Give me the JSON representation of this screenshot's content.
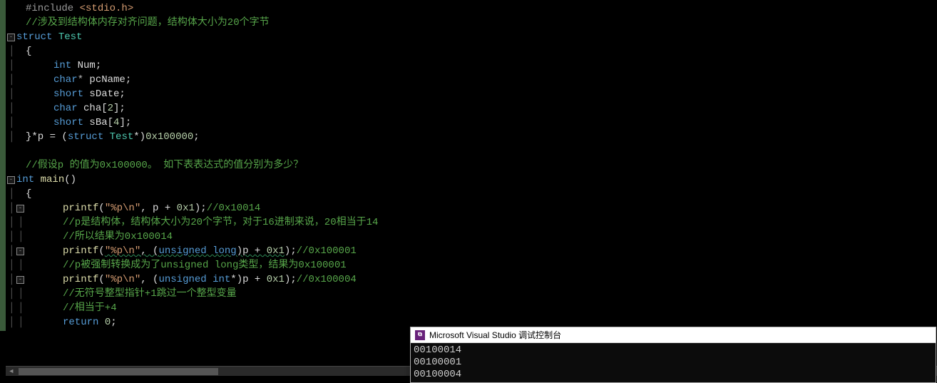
{
  "code": {
    "l1_inc": "#include",
    "l1_hdr": " <stdio.h>",
    "l2_cmt": "//涉及到结构体内存对齐问题，结构体大小为20个字节",
    "l3_struct": "struct",
    "l3_name": " Test",
    "l4_brace": "{",
    "l5_type": "int",
    "l5_name": " Num;",
    "l6_type": "char",
    "l6_ptr": "*",
    "l6_name": " pcName;",
    "l7_type": "short",
    "l7_name": " sDate;",
    "l8_type": "char",
    "l8_name": " cha[",
    "l8_n": "2",
    "l8_close": "];",
    "l9_type": "short",
    "l9_name": " sBa[",
    "l9_n": "4",
    "l9_close": "];",
    "l10_a": "}",
    "l10_b": "*p = (",
    "l10_c": "struct",
    "l10_d": " Test",
    "l10_e": "*)",
    "l10_f": "0x100000",
    "l10_g": ";",
    "l12_cmt": "//假设p 的值为0x100000。 如下表表达式的值分别为多少？",
    "l13_type": "int",
    "l13_fn": " main",
    "l13_p": "()",
    "l14_brace": "{",
    "l15_fn": "printf",
    "l15_op": "(",
    "l15_str": "\"%p\\n\"",
    "l15_mid": ", p + ",
    "l15_n": "0x1",
    "l15_cp": ");",
    "l15_cmt": "//0x10014",
    "l16_cmt": "//p是结构体，结构体大小为20个字节，对于16进制来说，20相当于14",
    "l17_cmt": "//所以结果为0x100014",
    "l18_fn": "printf",
    "l18_op": "(",
    "l18_str": "\"%p\\n\"",
    "l18_mid": ", (",
    "l18_ul": "unsigned long",
    "l18_mid2": ")p + ",
    "l18_n": "0x1",
    "l18_cp": ");",
    "l18_cmt": "//0x100001",
    "l19_cmt": "//p被强制转换成为了unsigned long类型，结果为0x100001",
    "l20_fn": "printf",
    "l20_op": "(",
    "l20_str": "\"%p\\n\"",
    "l20_mid": ", (",
    "l20_ui": "unsigned int",
    "l20_mid2": "*)p + ",
    "l20_n": "0x1",
    "l20_cp": ");",
    "l20_cmt": "//0x100004",
    "l21_cmt": "//无符号整型指针+1跳过一个整型变量",
    "l22_cmt": "//相当于+4",
    "l23_ret": "return",
    "l23_n": " 0",
    "l23_sc": ";"
  },
  "console": {
    "title": "Microsoft Visual Studio 调试控制台",
    "out1": "00100014",
    "out2": "00100001",
    "out3": "00100004"
  }
}
